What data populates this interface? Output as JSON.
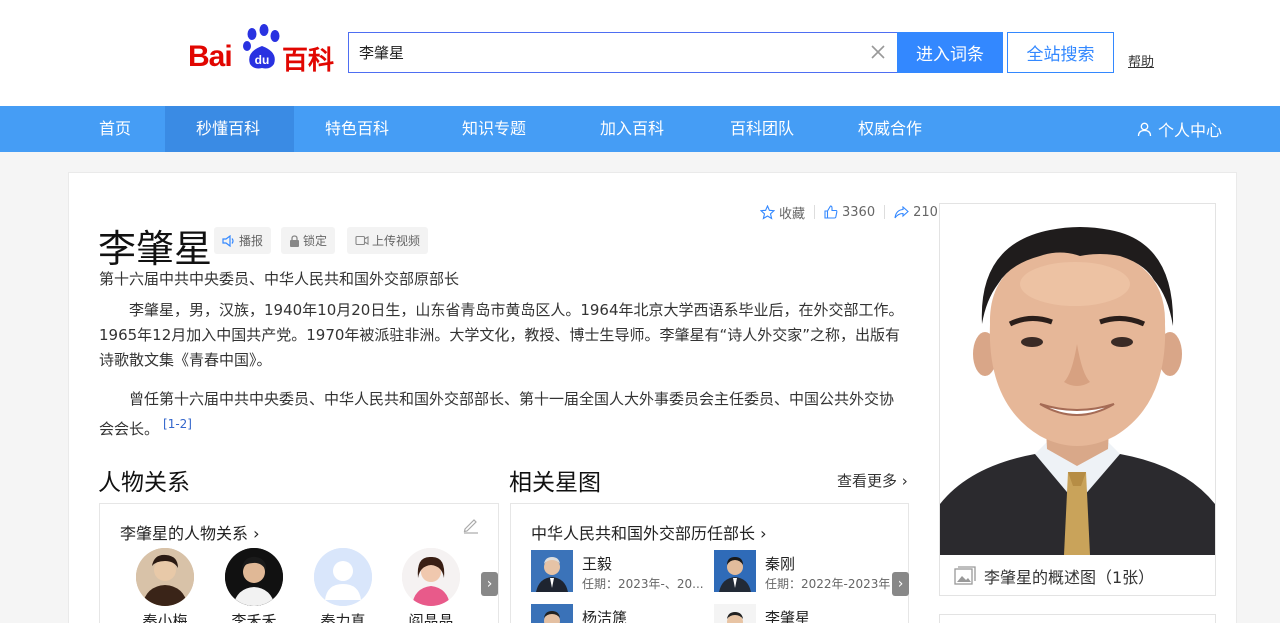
{
  "logo": {
    "bai": "Bai",
    "du": "du",
    "baike": "百科"
  },
  "search": {
    "value": "李肇星",
    "enter_label": "进入词条",
    "all_label": "全站搜索",
    "help_label": "帮助"
  },
  "nav": {
    "items": [
      "首页",
      "秒懂百科",
      "特色百科",
      "知识专题",
      "加入百科",
      "百科团队",
      "权威合作"
    ],
    "user_label": "个人中心"
  },
  "entry": {
    "title": "李肇星",
    "tags": [
      "播报",
      "锁定",
      "上传视频"
    ],
    "actions": {
      "favorite": "收藏",
      "likes": "3360",
      "shares": "210"
    },
    "subtitle": "第十六届中共中央委员、中华人民共和国外交部原部长",
    "para1": "李肇星，男，汉族，1940年10月20日生，山东省青岛市黄岛区人。1964年北京大学西语系毕业后，在外交部工作。1965年12月加入中国共产党。1970年被派驻非洲。大学文化，教授、博士生导师。李肇星有“诗人外交家”之称，出版有诗歌散文集《青春中国》。",
    "para2": "曾任第十六届中共中央委员、中华人民共和国外交部部长、第十一届全国人大外事委员会主任委员、中国公共外交协会会长。",
    "ref": "[1-2]"
  },
  "relations": {
    "section_title": "人物关系",
    "panel_title": "李肇星的人物关系",
    "people": [
      "秦小梅",
      "李禾禾",
      "秦力真",
      "阎晶晶"
    ]
  },
  "star_map": {
    "section_title": "相关星图",
    "see_more": "查看更多",
    "panel_title": "中华人民共和国外交部历任部长",
    "people": [
      {
        "name": "王毅",
        "term": "任期：2023年-、20..."
      },
      {
        "name": "秦刚",
        "term": "任期：2022年-2023年"
      },
      {
        "name": "杨洁篪",
        "term": ""
      },
      {
        "name": "李肇星",
        "term": ""
      }
    ]
  },
  "photo": {
    "caption": "李肇星的概述图（1张）"
  }
}
